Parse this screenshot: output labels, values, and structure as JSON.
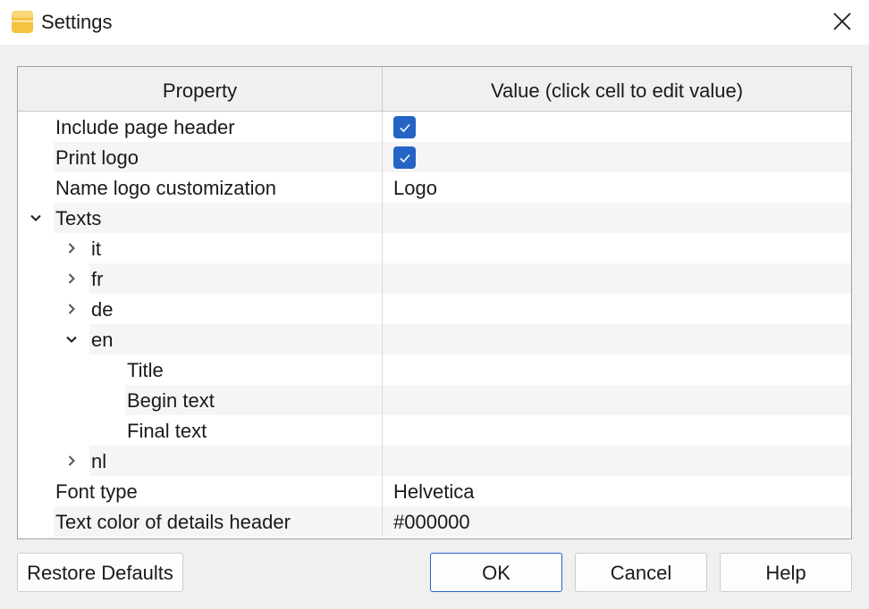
{
  "window": {
    "title": "Settings"
  },
  "table": {
    "columns": [
      "Property",
      "Value (click cell to edit value)"
    ],
    "rows": [
      {
        "label": "Include page header",
        "checked": true
      },
      {
        "label": "Print logo",
        "checked": true
      },
      {
        "label": "Name logo customization",
        "value": "Logo"
      },
      {
        "label": "Texts",
        "expanded": true
      },
      {
        "label": "it",
        "expanded": false
      },
      {
        "label": "fr",
        "expanded": false
      },
      {
        "label": "de",
        "expanded": false
      },
      {
        "label": "en",
        "expanded": true
      },
      {
        "label": "Title"
      },
      {
        "label": "Begin text"
      },
      {
        "label": "Final text"
      },
      {
        "label": "nl",
        "expanded": false
      },
      {
        "label": "Font type",
        "value": "Helvetica"
      },
      {
        "label": "Text color of details header",
        "value": "#000000"
      }
    ]
  },
  "buttons": {
    "restore": "Restore Defaults",
    "ok": "OK",
    "cancel": "Cancel",
    "help": "Help"
  },
  "colors": {
    "accent": "#2563c4",
    "app_icon": "#f5c242"
  },
  "icons": {
    "app": "app-icon",
    "close": "close-icon",
    "expand": "chevron-down-icon",
    "collapse": "chevron-right-icon",
    "check": "checkmark-icon"
  }
}
